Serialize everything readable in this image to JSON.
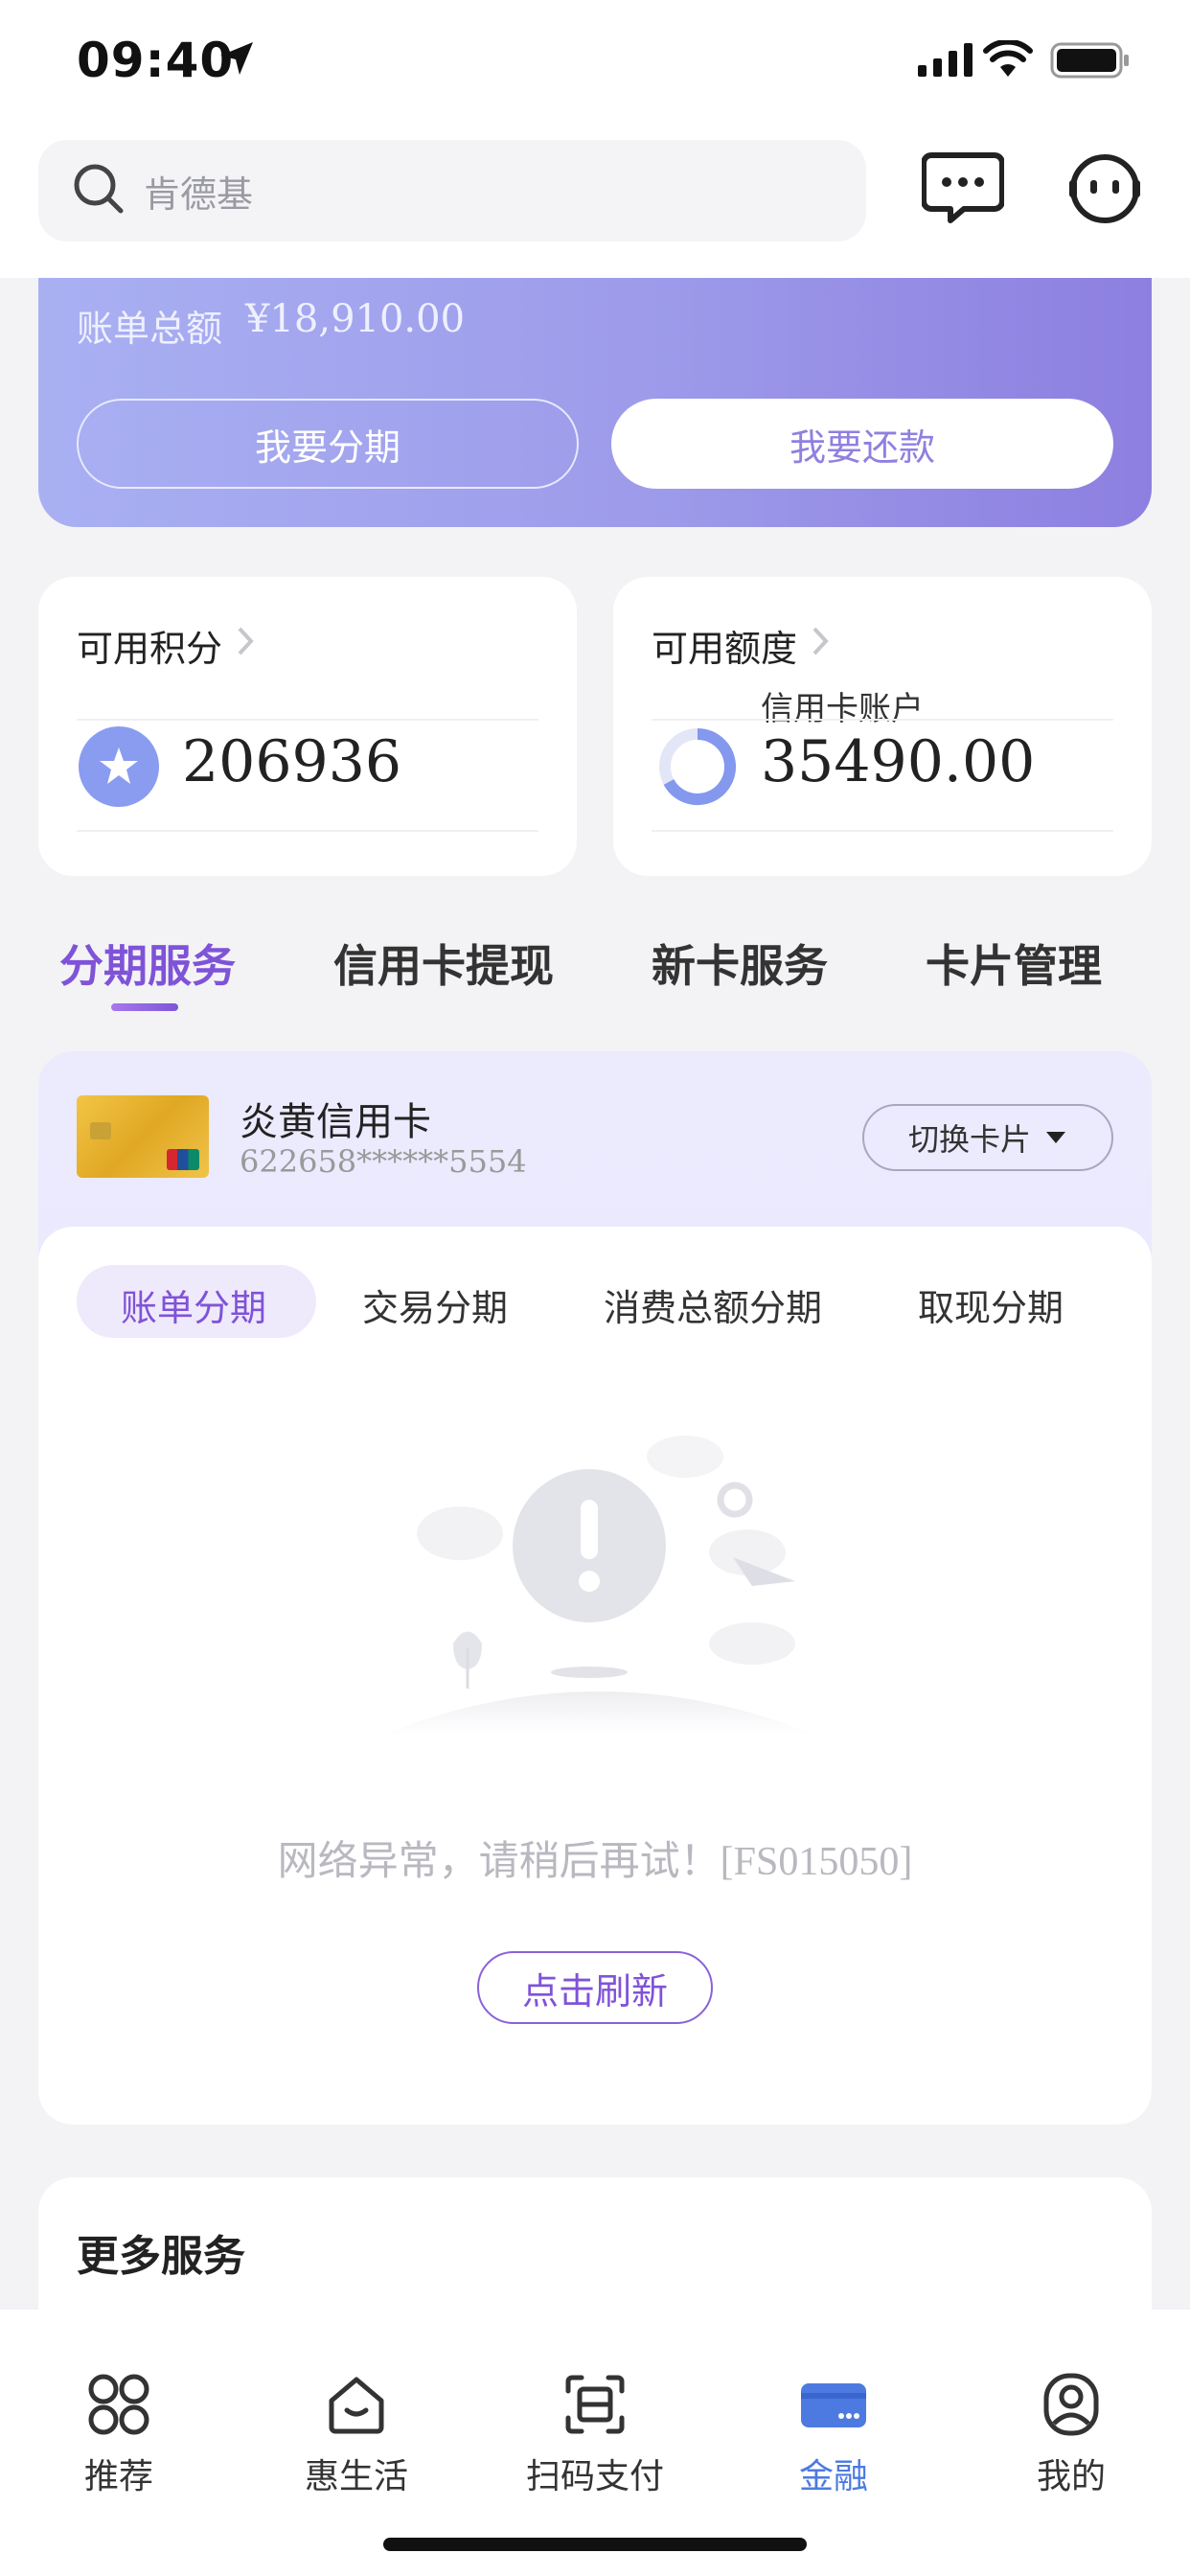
{
  "status_bar": {
    "time": "09:40"
  },
  "search": {
    "placeholder": "肯德基"
  },
  "banner": {
    "bill_label": "账单总额",
    "bill_amount": "¥18,910.00",
    "installment_button": "我要分期",
    "repay_button": "我要还款"
  },
  "points_card": {
    "title": "可用积分",
    "value": "206936"
  },
  "limit_card": {
    "title": "可用额度",
    "subtitle": "信用卡账户",
    "value": "35490.00"
  },
  "tabs": [
    {
      "label": "分期服务",
      "active": true
    },
    {
      "label": "信用卡提现",
      "active": false
    },
    {
      "label": "新卡服务",
      "active": false
    },
    {
      "label": "卡片管理",
      "active": false
    }
  ],
  "card": {
    "name": "炎黄信用卡",
    "number": "622658******5554",
    "switch_label": "切换卡片"
  },
  "subtabs": [
    {
      "label": "账单分期",
      "active": true
    },
    {
      "label": "交易分期",
      "active": false
    },
    {
      "label": "消费总额分期",
      "active": false
    },
    {
      "label": "取现分期",
      "active": false
    }
  ],
  "error": {
    "message": "网络异常，请稍后再试！[FS015050]",
    "refresh_label": "点击刷新"
  },
  "more_services": {
    "title": "更多服务"
  },
  "bottom_nav": [
    {
      "label": "推荐",
      "icon": "grid-icon",
      "active": false
    },
    {
      "label": "惠生活",
      "icon": "house-icon",
      "active": false
    },
    {
      "label": "扫码支付",
      "icon": "scan-icon",
      "active": false
    },
    {
      "label": "金融",
      "icon": "card-icon",
      "active": true
    },
    {
      "label": "我的",
      "icon": "person-icon",
      "active": false
    }
  ],
  "colors": {
    "accent": "#7f53d8",
    "nav_active": "#4d7ae0",
    "banner": "#9d9bea"
  }
}
